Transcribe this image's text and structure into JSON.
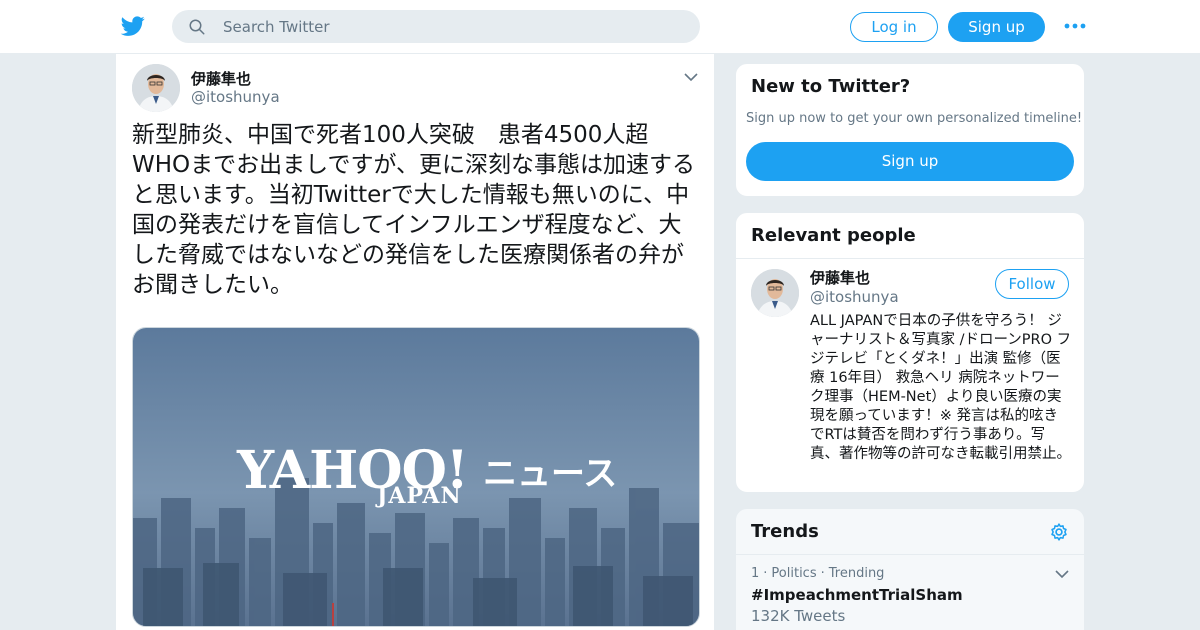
{
  "colors": {
    "accent": "#1da1f2",
    "background": "#e6ecf0",
    "secondary_text": "#657786"
  },
  "header": {
    "logo_icon": "twitter-bird-icon",
    "search_placeholder": "Search Twitter",
    "login_label": "Log in",
    "signup_label": "Sign up",
    "more_icon": "more-dots-icon"
  },
  "tweet": {
    "author_name": "伊藤隼也",
    "author_handle": "@itoshunya",
    "text": "新型肺炎、中国で死者100人突破　患者4500人超\nWHOまでお出ましですが、更に深刻な事態は加速すると思います。当初Twitterで大した情報も無いのに、中国の発表だけを盲信してインフルエンザ程度など、大した脅威ではないなどの発信をした医療関係者の弁がお聞きしたい。",
    "media": {
      "logo_text": "YAHOO!",
      "logo_sub": "JAPAN",
      "logo_news": "ニュース"
    }
  },
  "sidebar": {
    "new_to_twitter": {
      "title": "New to Twitter?",
      "subtitle": "Sign up now to get your own personalized timeline!",
      "signup_label": "Sign up"
    },
    "relevant_people": {
      "title": "Relevant people",
      "person": {
        "name": "伊藤隼也",
        "handle": "@itoshunya",
        "follow_label": "Follow",
        "bio": "ALL JAPANで日本の子供を守ろう！ ジャーナリスト＆写真家 /ドローンPRO フジテレビ「とくダネ！」出演 監修（医療 16年目） 救急ヘリ 病院ネットワーク理事（HEM-Net）より良い医療の実現を願っています！※ 発言は私的呟きでRTは賛否を問わず行う事あり。写真、著作物等の許可なき転載引用禁止。"
      }
    },
    "trends": {
      "title": "Trends",
      "items": [
        {
          "rank": "1",
          "category": "Politics",
          "status": "Trending",
          "name": "#ImpeachmentTrialSham",
          "count": "132K Tweets"
        }
      ]
    }
  }
}
